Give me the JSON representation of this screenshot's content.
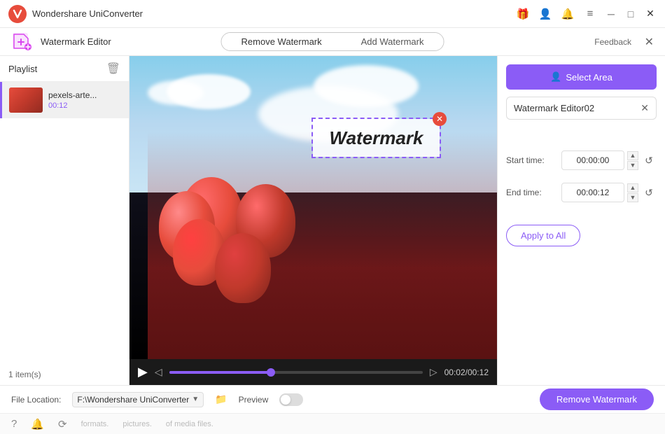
{
  "app": {
    "title": "Wondershare UniConverter",
    "logo_color": "#e74c3c"
  },
  "titlebar": {
    "icons": {
      "gift": "🎁",
      "user": "👤",
      "bell": "🔔",
      "menu": "≡",
      "minimize": "─",
      "maximize": "□",
      "close": "✕"
    }
  },
  "subheader": {
    "title": "Watermark Editor",
    "feedback": "Feedback",
    "close": "✕"
  },
  "tabs": {
    "remove": "Remove Watermark",
    "add": "Add Watermark"
  },
  "playlist": {
    "label": "Playlist",
    "count": "1 item(s)",
    "items": [
      {
        "name": "pexels-arte...",
        "duration": "00:12"
      }
    ]
  },
  "video": {
    "watermark_text": "Watermark",
    "current_time": "00:02",
    "total_time": "00:12",
    "time_display": "00:02/00:12"
  },
  "right_panel": {
    "select_area_btn": "Select Area",
    "watermark_tag": "Watermark Editor02",
    "start_time_label": "Start time:",
    "start_time_value": "00:00:00",
    "end_time_label": "End time:",
    "end_time_value": "00:00:12",
    "apply_all_btn": "Apply to All"
  },
  "bottom": {
    "file_location_label": "File Location:",
    "file_path": "F:\\Wondershare UniConverter",
    "preview_label": "Preview",
    "remove_watermark_btn": "Remove Watermark"
  },
  "footer": {
    "texts": [
      "formats.",
      "pictures.",
      "of media files."
    ]
  }
}
